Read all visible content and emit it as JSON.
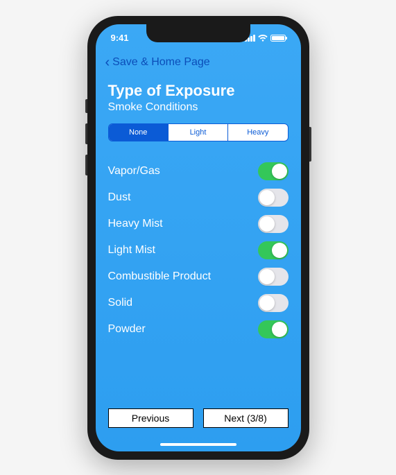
{
  "status": {
    "time": "9:41"
  },
  "nav": {
    "back_label": "Save & Home Page"
  },
  "header": {
    "title": "Type of Exposure",
    "subtitle": "Smoke Conditions"
  },
  "segmented": {
    "items": [
      "None",
      "Light",
      "Heavy"
    ],
    "selected_index": 0
  },
  "toggles": [
    {
      "label": "Vapor/Gas",
      "on": true
    },
    {
      "label": "Dust",
      "on": false
    },
    {
      "label": "Heavy Mist",
      "on": false
    },
    {
      "label": "Light Mist",
      "on": true
    },
    {
      "label": "Combustible Product",
      "on": false
    },
    {
      "label": "Solid",
      "on": false
    },
    {
      "label": "Powder",
      "on": true
    }
  ],
  "footer": {
    "previous_label": "Previous",
    "next_label": "Next (3/8)"
  }
}
